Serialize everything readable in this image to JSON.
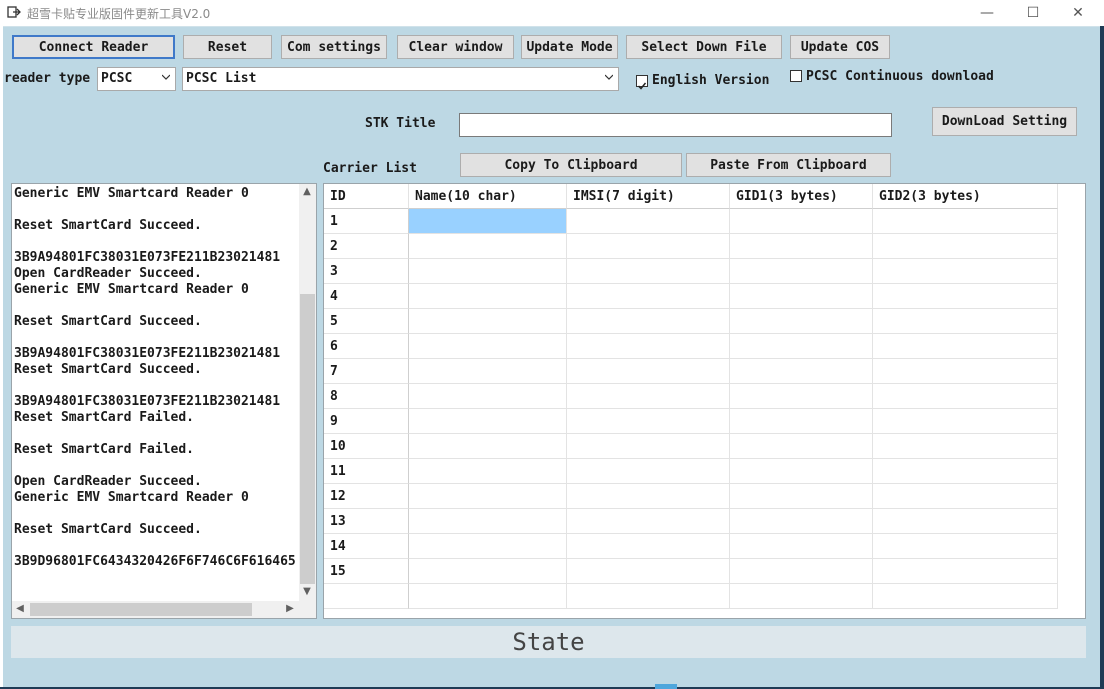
{
  "window": {
    "title": "超雪卡贴专业版固件更新工具V2.0",
    "controls": [
      "—",
      "☐",
      "✕"
    ]
  },
  "toolbar": {
    "connect_reader": "Connect Reader",
    "reset": "Reset",
    "com_settings": "Com settings",
    "clear_window": "Clear window",
    "update_mode": "Update Mode",
    "select_down_file": "Select Down File",
    "update_cos": "Update COS"
  },
  "reader": {
    "type_label": "reader type",
    "type_value": "PCSC",
    "list_value": "PCSC List",
    "english_version_label": "English Version",
    "english_version_checked": true,
    "pcsc_continuous_label": "PCSC Continuous download",
    "pcsc_continuous_checked": false
  },
  "stk": {
    "title_label": "STK Title",
    "title_value": "",
    "download_setting": "DownLoad Setting"
  },
  "carrier": {
    "list_label": "Carrier List",
    "copy_clipboard": "Copy To Clipboard",
    "paste_clipboard": "Paste From Clipboard"
  },
  "log": [
    "Generic EMV Smartcard Reader 0",
    "",
    "Reset SmartCard Succeed.",
    "",
    "3B9A94801FC38031E073FE211B23021481",
    "Open CardReader Succeed.",
    "Generic EMV Smartcard Reader 0",
    "",
    "Reset SmartCard Succeed.",
    "",
    "3B9A94801FC38031E073FE211B23021481",
    "Reset SmartCard Succeed.",
    "",
    "3B9A94801FC38031E073FE211B23021481",
    "Reset SmartCard Failed.",
    "",
    "Reset SmartCard Failed.",
    "",
    "Open CardReader Succeed.",
    "Generic EMV Smartcard Reader 0",
    "",
    "Reset SmartCard Succeed.",
    "",
    "3B9D96801FC6434320426F6F746C6F616465"
  ],
  "grid": {
    "columns": [
      "ID",
      "Name(10 char)",
      "IMSI(7 digit)",
      "GID1(3 bytes)",
      "GID2(3 bytes)"
    ],
    "rows": [
      "1",
      "2",
      "3",
      "4",
      "5",
      "6",
      "7",
      "8",
      "9",
      "10",
      "11",
      "12",
      "13",
      "14",
      "15",
      ""
    ],
    "selected_row": 0,
    "selected_col": 1,
    "selection_color": "#99d1ff"
  },
  "status": {
    "text": "State"
  }
}
